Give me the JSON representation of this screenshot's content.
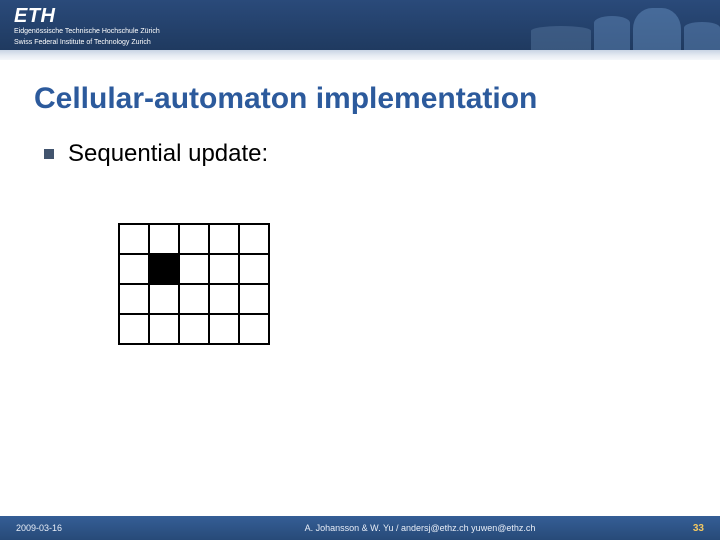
{
  "header": {
    "logo": "ETH",
    "subline1": "Eidgenössische Technische Hochschule Zürich",
    "subline2": "Swiss Federal Institute of Technology Zurich"
  },
  "title": "Cellular-automaton implementation",
  "bullets": [
    {
      "text": "Sequential update:"
    }
  ],
  "grid": {
    "rows": 4,
    "cols": 5,
    "filled": [
      [
        1,
        1
      ]
    ]
  },
  "footer": {
    "date": "2009-03-16",
    "authors": "A. Johansson & W. Yu / andersj@ethz.ch yuwen@ethz.ch",
    "page": "33"
  }
}
